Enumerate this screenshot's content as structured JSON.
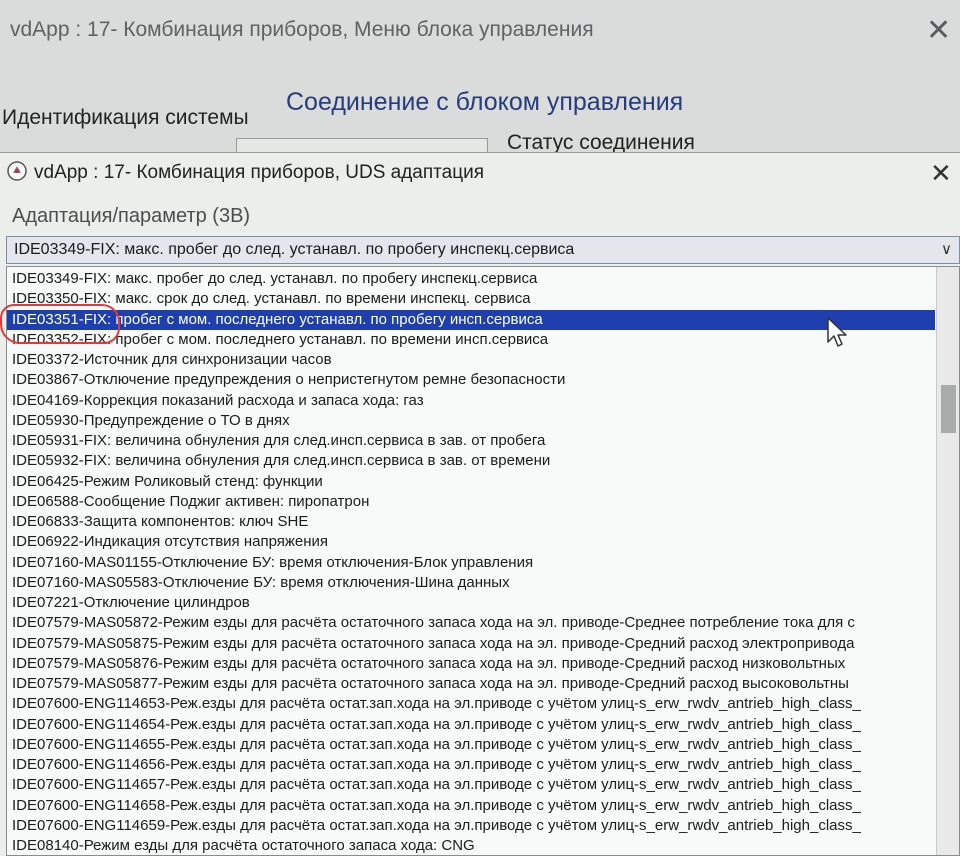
{
  "background_window": {
    "title": "vdApp : 17- Комбинация приборов,  Меню блока управления",
    "heading": "Соединение с блоком управления",
    "system_id_label": "Идентификация системы",
    "connection_status_label": "Статус соединения"
  },
  "dialog": {
    "title": "vdApp : 17- Комбинация приборов,  UDS адаптация",
    "parameter_label": "Адаптация/параметр (3B)",
    "combo_selected_value": "IDE03349-FIX: макс. пробег до след. устанавл. по пробегу инспекц.сервиса",
    "selected_index": 2,
    "items": [
      "IDE03349-FIX: макс. пробег до след. устанавл. по пробегу инспекц.сервиса",
      "IDE03350-FIX: макс. срок до след. устанавл. по времени инспекц. сервиса",
      "IDE03351-FIX: пробег с мом. последнего устанавл. по пробегу инсп.сервиса",
      "IDE03352-FIX: пробег с мом. последнего устанавл. по времени инсп.сервиса",
      "IDE03372-Источник для синхронизации часов",
      "IDE03867-Отключение предупреждения о непристегнутом ремне безопасности",
      "IDE04169-Коррекция показаний расхода и запаса хода: газ",
      "IDE05930-Предупреждение о ТО в днях",
      "IDE05931-FIX: величина обнуления для след.инсп.сервиса в зав. от пробега",
      "IDE05932-FIX: величина обнуления для след.инсп.сервиса в зав. от времени",
      "IDE06425-Режим Роликовый стенд: функции",
      "IDE06588-Сообщение Поджиг активен: пиропатрон",
      "IDE06833-Защита компонентов: ключ SHE",
      "IDE06922-Индикация отсутствия напряжения",
      "IDE07160-MAS01155-Отключение БУ: время отключения-Блок управления",
      "IDE07160-MAS05583-Отключение БУ: время отключения-Шина данных",
      "IDE07221-Отключение цилиндров",
      "IDE07579-MAS05872-Режим езды для расчёта остаточного запаса хода на эл. приводе-Среднее потребление тока для с",
      "IDE07579-MAS05875-Режим езды для расчёта остаточного запаса хода на эл. приводе-Средний расход электропривода",
      "IDE07579-MAS05876-Режим езды для расчёта остаточного запаса хода на эл. приводе-Средний расход низковольтных",
      "IDE07579-MAS05877-Режим езды для расчёта остаточного запаса хода на эл. приводе-Средний расход высоковольтны",
      "IDE07600-ENG114653-Реж.езды для расчёта остат.зап.хода на эл.приводе с учётом улиц-s_erw_rwdv_antrieb_high_class_",
      "IDE07600-ENG114654-Реж.езды для расчёта остат.зап.хода на эл.приводе с учётом улиц-s_erw_rwdv_antrieb_high_class_",
      "IDE07600-ENG114655-Реж.езды для расчёта остат.зап.хода на эл.приводе с учётом улиц-s_erw_rwdv_antrieb_high_class_",
      "IDE07600-ENG114656-Реж.езды для расчёта остат.зап.хода на эл.приводе с учётом улиц-s_erw_rwdv_antrieb_high_class_",
      "IDE07600-ENG114657-Реж.езды для расчёта остат.зап.хода на эл.приводе с учётом улиц-s_erw_rwdv_antrieb_high_class_",
      "IDE07600-ENG114658-Реж.езды для расчёта остат.зап.хода на эл.приводе с учётом улиц-s_erw_rwdv_antrieb_high_class_",
      "IDE07600-ENG114659-Реж.езды для расчёта остат.зап.хода на эл.приводе с учётом улиц-s_erw_rwdv_antrieb_high_class_",
      "IDE08140-Режим езды для расчёта остаточного запаса хода: CNG"
    ]
  },
  "icons": {
    "app": "vdapp-icon",
    "close": "close-icon",
    "dropdown": "chevron-down-icon",
    "cursor": "mouse-pointer-icon"
  },
  "colors": {
    "selection": "#1f3fae",
    "heading": "#263c7c",
    "annotation": "#e23a3a"
  }
}
